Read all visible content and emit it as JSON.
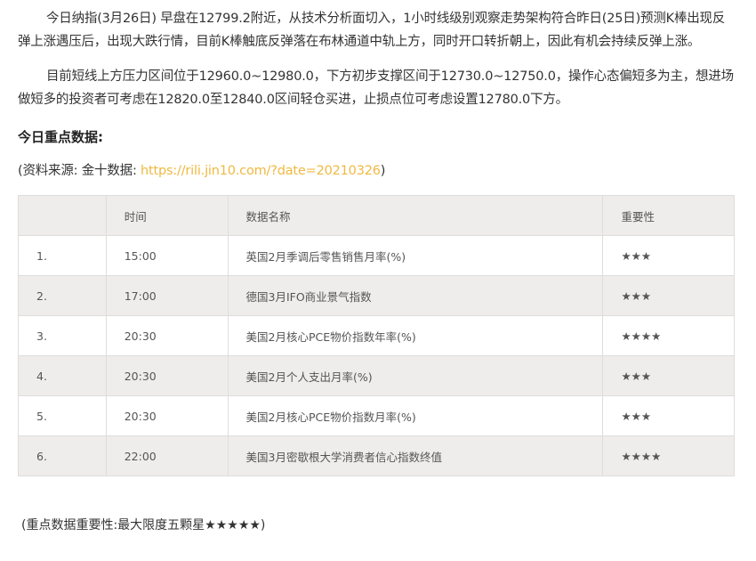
{
  "article": {
    "paragraph1": "今日纳指(3月26日) 早盘在12799.2附近，从技术分析面切入，1小时线级别观察走势架构符合昨日(25日)预测K棒出现反弹上涨遇压后，出现大跌行情，目前K棒触底反弹落在布林通道中轨上方，同时开口转折朝上，因此有机会持续反弹上涨。",
    "paragraph2": "目前短线上方压力区间位于12960.0~12980.0，下方初步支撑区间于12730.0~12750.0，操作心态偏短多为主，想进场做短多的投资者可考虑在12820.0至12840.0区间轻仓买进，止损点位可考虑设置12780.0下方。",
    "section_title": "今日重点数据:",
    "source_prefix": "(资料来源: 金十数据: ",
    "source_link": "https://rili.jin10.com/?date=20210326",
    "source_suffix": ")",
    "footnote": "(重点数据重要性:最大限度五颗星★★★★★)"
  },
  "table": {
    "headers": {
      "index": "",
      "time": "时间",
      "name": "数据名称",
      "importance": "重要性"
    },
    "rows": [
      {
        "index": "1.",
        "time": "15:00",
        "name": "英国2月季调后零售销售月率(%)",
        "importance": "★★★"
      },
      {
        "index": "2.",
        "time": "17:00",
        "name": "德国3月IFO商业景气指数",
        "importance": "★★★"
      },
      {
        "index": "3.",
        "time": "20:30",
        "name": "美国2月核心PCE物价指数年率(%)",
        "importance": "★★★★"
      },
      {
        "index": "4.",
        "time": "20:30",
        "name": "美国2月个人支出月率(%)",
        "importance": "★★★"
      },
      {
        "index": "5.",
        "time": "20:30",
        "name": "美国2月核心PCE物价指数月率(%)",
        "importance": "★★★"
      },
      {
        "index": "6.",
        "time": "22:00",
        "name": "美国3月密歇根大学消费者信心指数终值",
        "importance": "★★★★"
      }
    ]
  },
  "colors": {
    "link": "#f0b840",
    "row_shade": "#eeedeb",
    "border": "#dddddd",
    "text": "#333333"
  }
}
